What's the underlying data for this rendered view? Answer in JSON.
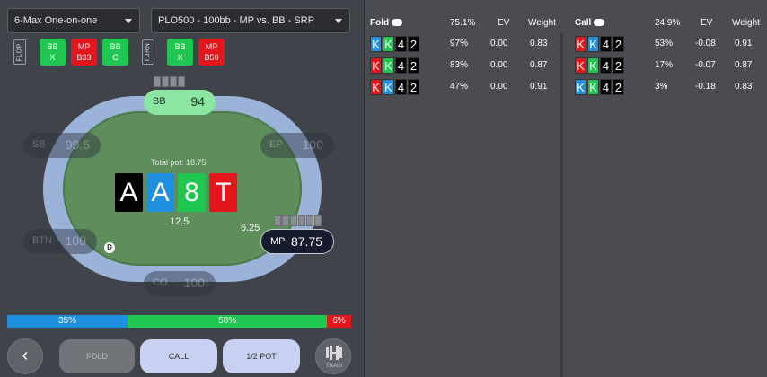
{
  "dropdowns": {
    "format": "6-Max One-on-one",
    "scenario": "PLO500 - 100bb - MP vs. BB - SRP"
  },
  "streets": {
    "flop": "FLOP",
    "turn": "TURN"
  },
  "actions": [
    {
      "label": "BB",
      "sub": "X",
      "color": "#1fc64f"
    },
    {
      "label": "MP",
      "sub": "B33",
      "color": "#e5161b"
    },
    {
      "label": "BB",
      "sub": "C",
      "color": "#1fc64f"
    },
    {
      "label": "BB",
      "sub": "X",
      "color": "#1fc64f"
    },
    {
      "label": "MP",
      "sub": "B50",
      "color": "#e5161b"
    }
  ],
  "seats": {
    "bb": {
      "name": "BB",
      "stack": "94"
    },
    "sb": {
      "name": "SB",
      "stack": "99.5"
    },
    "ep": {
      "name": "EP",
      "stack": "100"
    },
    "btn": {
      "name": "BTN",
      "stack": "100"
    },
    "mp": {
      "name": "MP",
      "stack": "87.75"
    },
    "co": {
      "name": "CO",
      "stack": "100"
    }
  },
  "table": {
    "total_pot": "Total pot: 18.75",
    "pot": "12.5",
    "mp_bet": "6.25",
    "dealer": "D",
    "board": [
      {
        "rank": "A",
        "suit": "black"
      },
      {
        "rank": "A",
        "suit": "blue"
      },
      {
        "rank": "8",
        "suit": "green"
      },
      {
        "rank": "T",
        "suit": "red"
      }
    ]
  },
  "freq_bar": {
    "fold": "35%",
    "call": "58%",
    "raise": "6%",
    "fold_frac": 0.35,
    "call_frac": 0.58,
    "raise_frac": 0.07
  },
  "buttons": {
    "fold": "FOLD",
    "call": "CALL",
    "pot": "1/2 POT",
    "train": "TRAIN",
    "back": "‹"
  },
  "fold_panel": {
    "title": "Fold",
    "pct": "75.1%",
    "ev": "EV",
    "weight": "Weight",
    "rows": [
      {
        "cards": [
          [
            "K",
            "blue"
          ],
          [
            "K",
            "green"
          ],
          [
            "4",
            "black"
          ],
          [
            "2",
            "black"
          ]
        ],
        "pct": "97%",
        "ev": "0.00",
        "w": "0.83"
      },
      {
        "cards": [
          [
            "K",
            "red"
          ],
          [
            "K",
            "green"
          ],
          [
            "4",
            "black"
          ],
          [
            "2",
            "black"
          ]
        ],
        "pct": "83%",
        "ev": "0.00",
        "w": "0.87"
      },
      {
        "cards": [
          [
            "K",
            "red"
          ],
          [
            "K",
            "blue"
          ],
          [
            "4",
            "black"
          ],
          [
            "2",
            "black"
          ]
        ],
        "pct": "47%",
        "ev": "0.00",
        "w": "0.91"
      }
    ]
  },
  "call_panel": {
    "title": "Call",
    "pct": "24.9%",
    "ev": "EV",
    "weight": "Weight",
    "rows": [
      {
        "cards": [
          [
            "K",
            "red"
          ],
          [
            "K",
            "blue"
          ],
          [
            "4",
            "black"
          ],
          [
            "2",
            "black"
          ]
        ],
        "pct": "53%",
        "ev": "-0.08",
        "w": "0.91"
      },
      {
        "cards": [
          [
            "K",
            "red"
          ],
          [
            "K",
            "green"
          ],
          [
            "4",
            "black"
          ],
          [
            "2",
            "black"
          ]
        ],
        "pct": "17%",
        "ev": "-0.07",
        "w": "0.87"
      },
      {
        "cards": [
          [
            "K",
            "blue"
          ],
          [
            "K",
            "green"
          ],
          [
            "4",
            "black"
          ],
          [
            "2",
            "black"
          ]
        ],
        "pct": "3%",
        "ev": "-0.18",
        "w": "0.83"
      }
    ]
  }
}
